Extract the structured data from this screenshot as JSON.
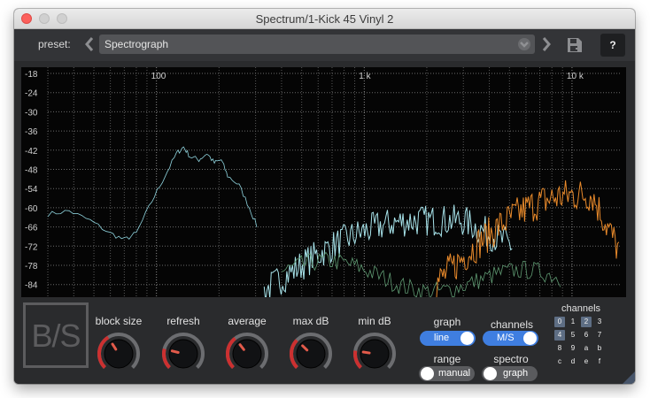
{
  "window": {
    "title": "Spectrum/1-Kick 45 Vinyl 2"
  },
  "header": {
    "preset_label": "preset:",
    "preset_value": "Spectrograph",
    "help_label": "?"
  },
  "plot": {
    "y_labels": [
      "-18",
      "-24",
      "-30",
      "-36",
      "-42",
      "-48",
      "-54",
      "-60",
      "-66",
      "-72",
      "-78",
      "-84"
    ],
    "x_labels": [
      "100",
      "1 k",
      "10 k"
    ]
  },
  "logo": {
    "text": "B/S"
  },
  "knobs": [
    {
      "label": "block size",
      "value": 0.38
    },
    {
      "label": "refresh",
      "value": 0.22
    },
    {
      "label": "average",
      "value": 0.36
    },
    {
      "label": "max dB",
      "value": 0.33
    },
    {
      "label": "min dB",
      "value": 0.2
    }
  ],
  "switches": {
    "graph": {
      "label": "graph",
      "value": "line",
      "on": true
    },
    "channels": {
      "label": "channels",
      "value": "M/S",
      "on": true
    },
    "range": {
      "label": "range",
      "value": "manual",
      "on": false
    },
    "spectro": {
      "label": "spectro",
      "value": "graph",
      "on": false
    }
  },
  "channel_grid": {
    "title": "channels",
    "cells": [
      "0",
      "1",
      "2",
      "3",
      "4",
      "5",
      "6",
      "7",
      "8",
      "9",
      "a",
      "b",
      "c",
      "d",
      "e",
      "f"
    ],
    "active": [
      "0",
      "2",
      "4"
    ]
  },
  "colors": {
    "mid_trace": "#8fd4de",
    "side_trace": "#e98a2b",
    "toggle_on": "#3f7ee0",
    "knob_arc": "#cc3030"
  }
}
